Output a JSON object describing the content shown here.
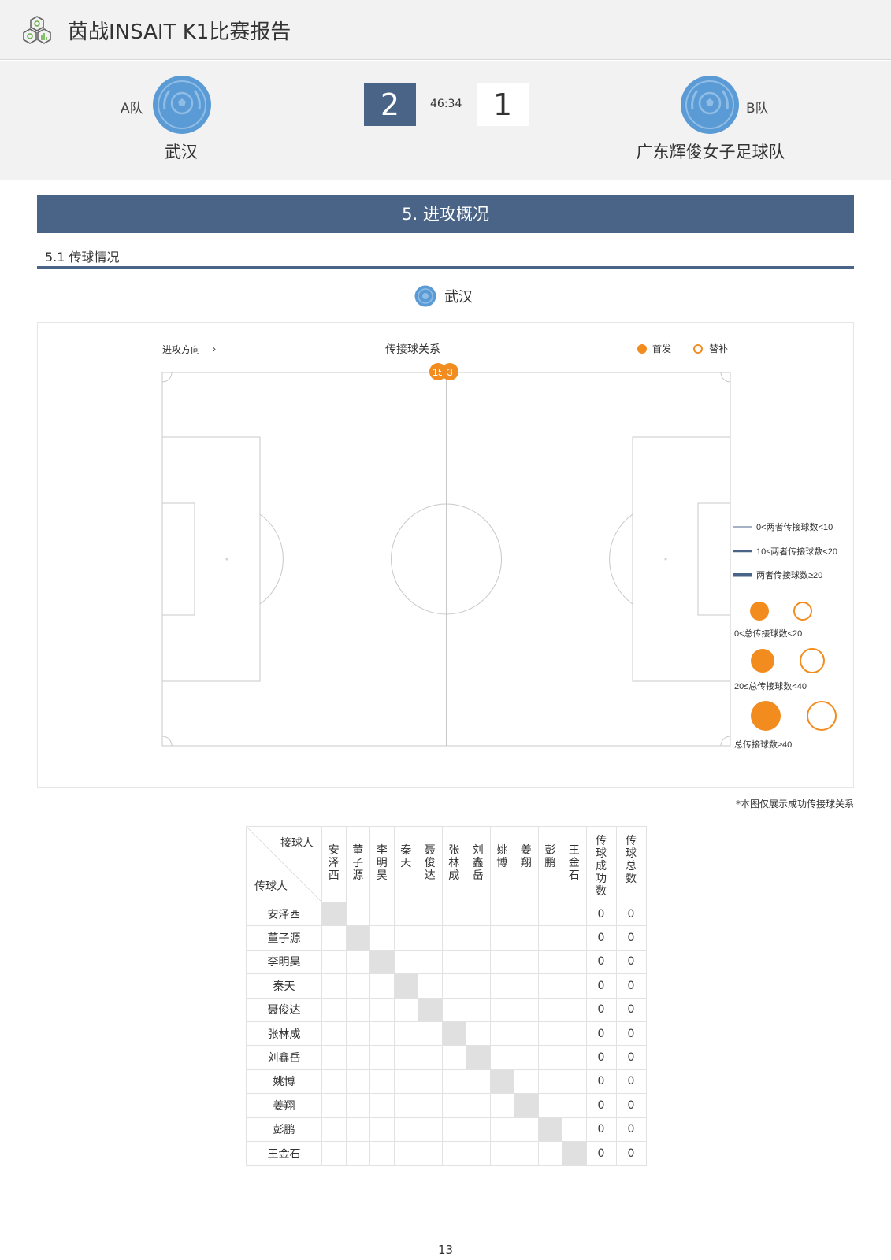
{
  "header": {
    "title": "茵战INSAIT K1比赛报告",
    "logo_icon": "hexagon-network-logo",
    "accent_color": "#4a6488"
  },
  "match": {
    "team_a": {
      "label": "A队",
      "name": "武汉",
      "score": "2",
      "badge_color": "#5b9bd5"
    },
    "team_b": {
      "label": "B队",
      "name": "广东辉俊女子足球队",
      "score": "1",
      "badge_color": "#5b9bd5"
    },
    "time": "46:34"
  },
  "section": {
    "title": "5. 进攻概况",
    "subtitle": "5.1 传球情况",
    "team": "武汉"
  },
  "chart": {
    "direction_label": "进攻方向",
    "direction_arrow": "›",
    "title": "传接球关系",
    "legend_starter": "首发",
    "legend_sub": "替补",
    "line_legend": [
      "0<两者传接球数<10",
      "10≤两者传接球数<20",
      "两者传接球数≥20"
    ],
    "circle_legend": [
      "0<总传接球数<20",
      "20≤总传接球数<40",
      "总传接球数≥40"
    ],
    "colors": {
      "node": "#f28c1e",
      "line": "#4a6488",
      "pitch": "#c8c8c8"
    },
    "note": "*本图仅展示成功传接球关系"
  },
  "chart_data": {
    "type": "pass-network",
    "nodes": [
      {
        "number": "15",
        "type": "starter"
      },
      {
        "number": "3",
        "type": "starter"
      }
    ],
    "links": []
  },
  "table": {
    "receiver_label": "接球人",
    "passer_label": "传球人",
    "players": [
      "安泽西",
      "董子源",
      "李明昊",
      "秦天",
      "聂俊达",
      "张林成",
      "刘鑫岳",
      "姚博",
      "姜翔",
      "彭鹏",
      "王金石"
    ],
    "success_label": "传球成功数",
    "total_label": "传球总数",
    "rows": [
      {
        "success": "0",
        "total": "0"
      },
      {
        "success": "0",
        "total": "0"
      },
      {
        "success": "0",
        "total": "0"
      },
      {
        "success": "0",
        "total": "0"
      },
      {
        "success": "0",
        "total": "0"
      },
      {
        "success": "0",
        "total": "0"
      },
      {
        "success": "0",
        "total": "0"
      },
      {
        "success": "0",
        "total": "0"
      },
      {
        "success": "0",
        "total": "0"
      },
      {
        "success": "0",
        "total": "0"
      },
      {
        "success": "0",
        "total": "0"
      }
    ]
  },
  "page_number": "13"
}
